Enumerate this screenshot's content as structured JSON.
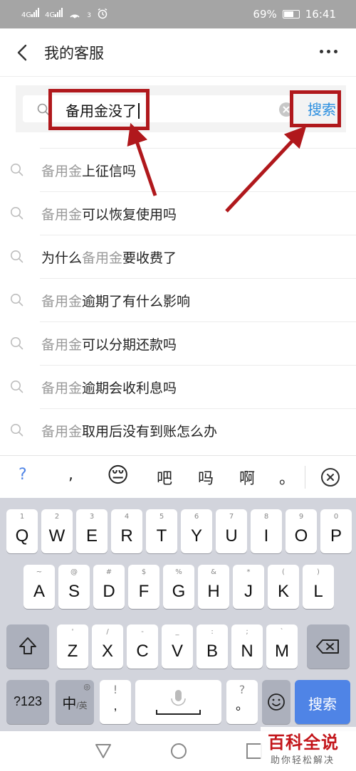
{
  "status_bar": {
    "signal_1": "4G",
    "signal_2": "4G",
    "hotspot_count": "3",
    "battery": "69%",
    "time": "16:41"
  },
  "header": {
    "title": "我的客服"
  },
  "search": {
    "value": "备用金没了",
    "button_label": "搜索"
  },
  "suggestions": [
    {
      "prefix": "",
      "keyword": "备用金",
      "suffix": "上征信吗"
    },
    {
      "prefix": "",
      "keyword": "备用金",
      "suffix": "可以恢复使用吗"
    },
    {
      "prefix": "为什么",
      "keyword": "备用金",
      "suffix": "要收费了"
    },
    {
      "prefix": "",
      "keyword": "备用金",
      "suffix": "逾期了有什么影响"
    },
    {
      "prefix": "",
      "keyword": "备用金",
      "suffix": "可以分期还款吗"
    },
    {
      "prefix": "",
      "keyword": "备用金",
      "suffix": "逾期会收利息吗"
    },
    {
      "prefix": "",
      "keyword": "备用金",
      "suffix": "取用后没有到账怎么办"
    }
  ],
  "candidates": {
    "question": "?",
    "comma": ",",
    "emoji": "😔",
    "c1": "吧",
    "c2": "吗",
    "c3": "啊",
    "period": "。"
  },
  "keyboard": {
    "row1": [
      {
        "sub": "1",
        "main": "Q"
      },
      {
        "sub": "2",
        "main": "W"
      },
      {
        "sub": "3",
        "main": "E"
      },
      {
        "sub": "4",
        "main": "R"
      },
      {
        "sub": "5",
        "main": "T"
      },
      {
        "sub": "6",
        "main": "Y"
      },
      {
        "sub": "7",
        "main": "U"
      },
      {
        "sub": "8",
        "main": "I"
      },
      {
        "sub": "9",
        "main": "O"
      },
      {
        "sub": "0",
        "main": "P"
      }
    ],
    "row2": [
      {
        "sub": "~",
        "main": "A"
      },
      {
        "sub": "@",
        "main": "S"
      },
      {
        "sub": "#",
        "main": "D"
      },
      {
        "sub": "$",
        "main": "F"
      },
      {
        "sub": "%",
        "main": "G"
      },
      {
        "sub": "&",
        "main": "H"
      },
      {
        "sub": "*",
        "main": "J"
      },
      {
        "sub": "(",
        "main": "K"
      },
      {
        "sub": ")",
        "main": "L"
      }
    ],
    "row3": [
      {
        "sub": "'",
        "main": "Z"
      },
      {
        "sub": "/",
        "main": "X"
      },
      {
        "sub": "-",
        "main": "C"
      },
      {
        "sub": "_",
        "main": "V"
      },
      {
        "sub": ":",
        "main": "B"
      },
      {
        "sub": ";",
        "main": "N"
      },
      {
        "sub": "`",
        "main": "M"
      }
    ],
    "num_key": "?123",
    "lang_key": "中",
    "lang_key_sub": "/英",
    "punct_main": "!",
    "punct_sub": ",",
    "punct2_sub": "?",
    "punct2_main": "。",
    "enter_label": "搜索"
  },
  "watermark": {
    "title": "百科全说",
    "subtitle": "助你轻松解决"
  },
  "colors": {
    "accent": "#2b8fe0",
    "annotation": "#b0181c",
    "enter_key": "#4f84e6"
  }
}
